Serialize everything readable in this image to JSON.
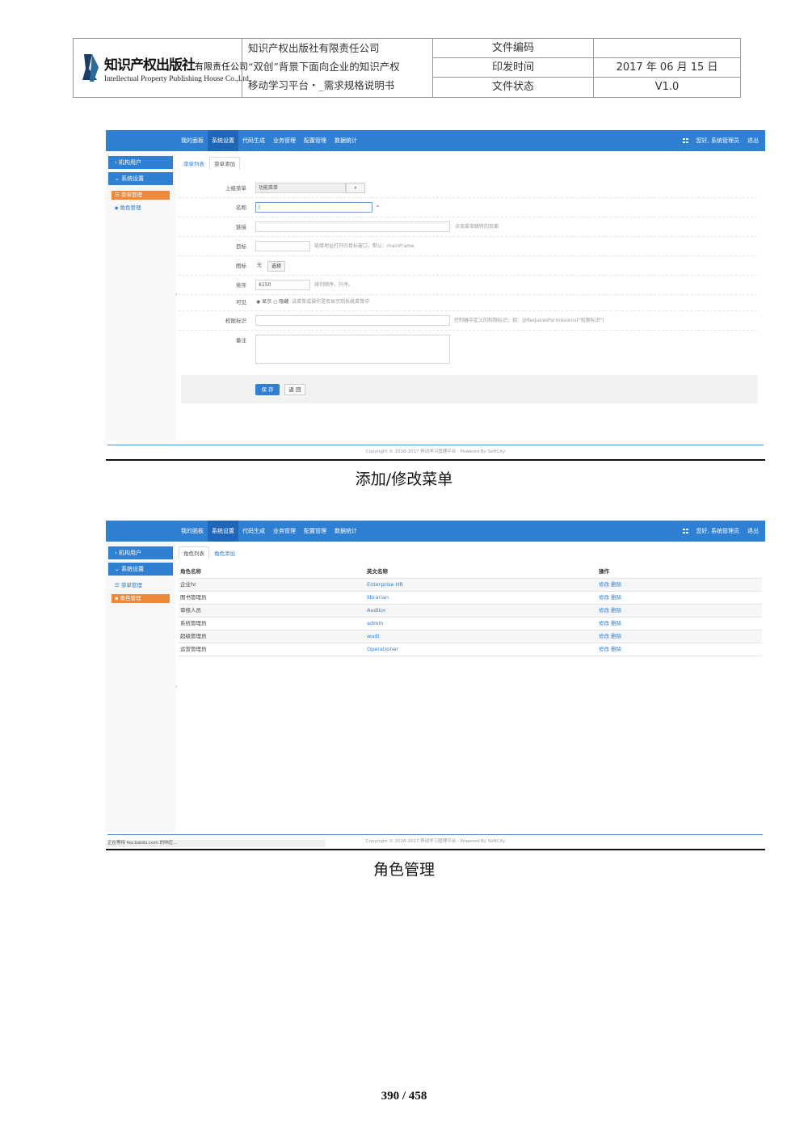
{
  "header": {
    "logo_cn": "知识产权出版社",
    "logo_cn_small": "有限责任公司",
    "logo_en": "Intellectual Property Publishing House Co.,Ltd.",
    "title_lines": [
      "知识产权出版社有限责任公司",
      "“双创”背景下面向企业的知识产权",
      "移动学习平台・_需求规格说明书"
    ],
    "rows": [
      {
        "label": "文件编码",
        "value": ""
      },
      {
        "label": "印发时间",
        "value": "2017 年 06 月 15 日"
      },
      {
        "label": "文件状态",
        "value": "V1.0"
      }
    ]
  },
  "nav": {
    "items": [
      "我的面板",
      "系统设置",
      "代码生成",
      "业务管理",
      "配置管理",
      "数据统计"
    ],
    "active_index": 1,
    "greeting": "您好, 系统管理员",
    "logout": "退出"
  },
  "sidebar": {
    "group1": "机构用户",
    "group2": "系统设置",
    "item_menu": "菜单管理",
    "item_role": "角色管理"
  },
  "form_screen": {
    "tabs": [
      "菜单列表",
      "菜单添加"
    ],
    "fields": {
      "parent_label": "上级菜单",
      "parent_value": "功能菜单",
      "name_label": "名称",
      "name_required": "*",
      "link_label": "链接",
      "link_hint": "点击菜单跳转的页面",
      "target_label": "目标",
      "target_hint": "链接地址打开的目标窗口，默认：mainFrame",
      "icon_label": "图标",
      "icon_value": "无",
      "icon_button": "选择",
      "sort_label": "排序",
      "sort_value": "6150",
      "sort_hint": "排列顺序，升序。",
      "visible_label": "可见",
      "visible_show": "显示",
      "visible_hide": "隐藏",
      "visible_hint": "该菜单或操作是否显示到系统菜单中",
      "perm_label": "权限标识",
      "perm_hint": "控制器中定义的权限标识，如：@RequiresPermissions(\"权限标识\")",
      "remark_label": "备注"
    },
    "save": "保 存",
    "back": "返 回",
    "caption": "添加/修改菜单"
  },
  "role_screen": {
    "tabs": [
      "角色列表",
      "角色添加"
    ],
    "columns": [
      "角色名称",
      "英文名称",
      "操作"
    ],
    "rows": [
      {
        "name": "企业hr",
        "en": "Enterprise HR",
        "ops": "修改 删除"
      },
      {
        "name": "图书管理员",
        "en": "librarian",
        "ops": "修改 删除"
      },
      {
        "name": "审核人员",
        "en": "Auditor",
        "ops": "修改 删除"
      },
      {
        "name": "系统管理员",
        "en": "admin",
        "ops": "修改 删除"
      },
      {
        "name": "超级管理员",
        "en": "wudi",
        "ops": "修改 删除"
      },
      {
        "name": "运营管理员",
        "en": "Operationer",
        "ops": "修改 删除"
      }
    ],
    "status": "正在等待 fex.baidu.com 的响应...",
    "caption": "角色管理"
  },
  "footer_copy": "Copyright © 2016-2017 移动学习管理平台 - Powered By SoftCity",
  "page_number": "390 / 458"
}
